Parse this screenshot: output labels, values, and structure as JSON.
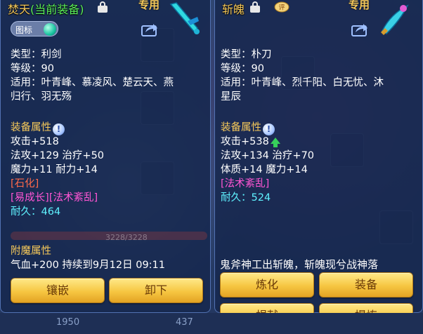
{
  "left": {
    "name": "焚天",
    "current_tag": "(当前装备)",
    "zhuanyong": "专用",
    "icon_tag": "图标",
    "lines": [
      "类型：利剑",
      "等级：90",
      "适用：叶青峰、慕凌风、楚云天、燕",
      "归行、羽无殇"
    ],
    "attr_title": "装备属性",
    "attrs": [
      "攻击+518",
      "法攻+129 治疗+50",
      "魔力+11 耐力+14"
    ],
    "special1": "[石化]",
    "special2": "[易成长][法术紊乱]",
    "durability_label": "耐久：",
    "durability_value": "464",
    "enchant_title": "附魔属性",
    "enchant_line": "气血+200 持续到9月12日 09:11",
    "btn_inlay": "镶嵌",
    "btn_unequip": "卸下"
  },
  "right": {
    "name": "斩魄",
    "zhuanyong": "专用",
    "lines": [
      "类型：朴刀",
      "等级：90",
      "适用：叶青峰、烈千阳、白无忧、沐",
      "星辰"
    ],
    "attr_title": "装备属性",
    "attrs": [
      "攻击+538",
      "法攻+134 治疗+70",
      "体质+14 魔力+14"
    ],
    "special1": "[法术紊乱]",
    "durability_label": "耐久：",
    "durability_value": "524",
    "banner": "鬼斧神工出斩魄，斩魄现兮战神落",
    "btn_refine": "炼化",
    "btn_equip": "装备",
    "btn_donate": "捐献",
    "btn_extract": "提炼"
  },
  "background": {
    "hp_bar_text": "3228/3228",
    "bottom_texts": [
      "1950",
      "437"
    ]
  },
  "colors": {
    "gold": "#f6c95a",
    "green": "#5bf15b",
    "pink": "#ff55d4",
    "cyan": "#5ff2ff",
    "panel": "#16284e"
  }
}
